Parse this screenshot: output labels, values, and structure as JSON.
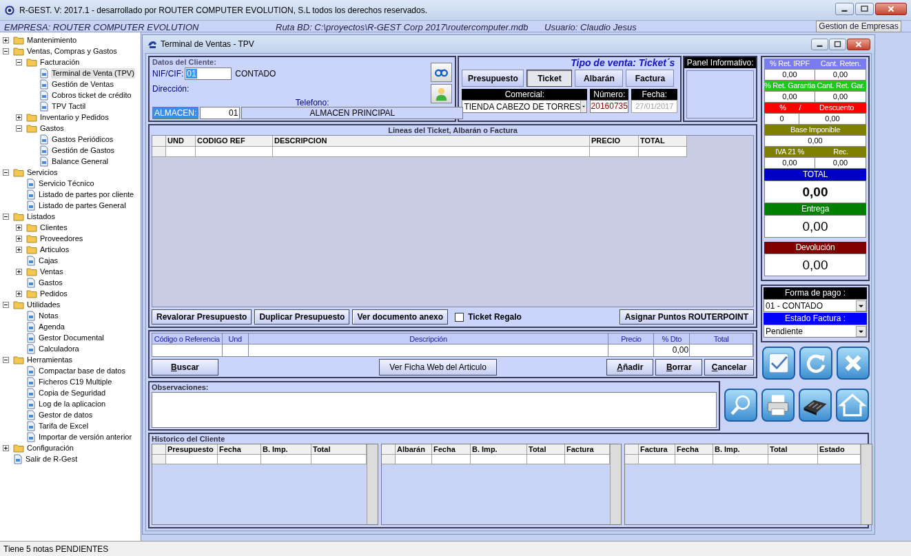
{
  "app": {
    "title": "R-GEST. V: 2017.1 - desarrollado por ROUTER COMPUTER EVOLUTION, S.L todos los derechos reservados."
  },
  "info_bar": {
    "empresa": "EMPRESA: ROUTER COMPUTER EVOLUTION",
    "ruta": "Ruta BD: C:\\proyectos\\R-GEST Corp 2017\\routercomputer.mdb",
    "usuario": "Usuario: Claudio Jesus",
    "button": "Gestion de Empresas"
  },
  "tree": [
    {
      "label": "Mantenimiento",
      "expanded": false,
      "selected": false
    },
    {
      "label": "Ventas, Compras y Gastos",
      "expanded": true,
      "selected": false,
      "children": [
        {
          "label": "Facturación",
          "expanded": true,
          "selected": false,
          "children": [
            {
              "label": "Terminal de Venta (TPV)",
              "selected": true
            },
            {
              "label": "Gestión de Ventas",
              "selected": false
            },
            {
              "label": "Cobros ticket de crédito",
              "selected": false
            },
            {
              "label": "TPV Tactil",
              "selected": false
            }
          ]
        },
        {
          "label": "Inventario y Pedidos",
          "expanded": false,
          "selected": false
        },
        {
          "label": "Gastos",
          "expanded": true,
          "selected": false,
          "children": [
            {
              "label": "Gastos Periódicos",
              "selected": false
            },
            {
              "label": "Gestión de Gastos",
              "selected": false
            },
            {
              "label": "Balance General",
              "selected": false
            }
          ]
        }
      ]
    },
    {
      "label": "Servicios",
      "expanded": true,
      "selected": false,
      "children": [
        {
          "label": "Servicio Técnico",
          "selected": false
        },
        {
          "label": "Listado de partes por cliente",
          "selected": false
        },
        {
          "label": "Listado de partes General",
          "selected": false
        }
      ]
    },
    {
      "label": "Listados",
      "expanded": true,
      "selected": false,
      "children": [
        {
          "label": "Clientes",
          "expanded": false,
          "selected": false
        },
        {
          "label": "Proveedores",
          "expanded": false,
          "selected": false
        },
        {
          "label": "Articulos",
          "expanded": false,
          "selected": false
        },
        {
          "label": "Cajas",
          "selected": false
        },
        {
          "label": "Ventas",
          "expanded": false,
          "selected": false
        },
        {
          "label": "Gastos",
          "selected": false
        },
        {
          "label": "Pedidos",
          "expanded": false,
          "selected": false
        }
      ]
    },
    {
      "label": "Utilidades",
      "expanded": true,
      "selected": false,
      "children": [
        {
          "label": "Notas",
          "selected": false
        },
        {
          "label": "Agenda",
          "selected": false
        },
        {
          "label": "Gestor Documental",
          "selected": false
        },
        {
          "label": "Calculadora",
          "selected": false
        }
      ]
    },
    {
      "label": "Herramientas",
      "expanded": true,
      "selected": false,
      "children": [
        {
          "label": "Compactar base de datos",
          "selected": false
        },
        {
          "label": "Ficheros C19 Multiple",
          "selected": false
        },
        {
          "label": "Copia de Seguridad",
          "selected": false
        },
        {
          "label": "Log de la aplicacion",
          "selected": false
        },
        {
          "label": "Gestor de datos",
          "selected": false
        },
        {
          "label": "Tarifa de Excel",
          "selected": false
        },
        {
          "label": "Importar de versión anterior",
          "selected": false
        }
      ]
    },
    {
      "label": "Configuración",
      "expanded": false,
      "selected": false
    },
    {
      "label": "Salir de R-Gest",
      "selected": false
    }
  ],
  "window": {
    "title": "Terminal de Ventas - TPV"
  },
  "cliente": {
    "heading": "Datos del Cliente:",
    "nif_label": "NIF/CIF:",
    "nif_value": "01",
    "nombre": "CONTADO",
    "direccion_label": "Dirección:",
    "telefono_label": "Telefono:",
    "almacen_label": "ALMACEN:",
    "almacen_code": "01",
    "almacen_name": "ALMACEN PRINCIPAL"
  },
  "venta": {
    "heading": "Tipo de venta: Ticket´s",
    "types": [
      {
        "label": "Presupuesto",
        "selected": false
      },
      {
        "label": "Ticket",
        "selected": true
      },
      {
        "label": "Albarán",
        "selected": false
      },
      {
        "label": "Factura",
        "selected": false
      }
    ],
    "comercial_label": "Comercial:",
    "comercial": "TIENDA CABEZO DE TORRES",
    "numero_label": "Número:",
    "numero": "20160735",
    "fecha_label": "Fecha:",
    "fecha": "27/01/2017"
  },
  "panel_info": {
    "heading": "Panel Informativo:"
  },
  "lineas": {
    "title": "Lineas del Ticket, Albarán o Factura",
    "columns": [
      "UND",
      "CODIGO REF",
      "DESCRIPCION",
      "PRECIO",
      "TOTAL"
    ],
    "buttons": [
      "Revalorar Presupuesto",
      "Duplicar Presupuesto",
      "Ver documento anexo"
    ],
    "gift": {
      "label": "Ticket Regalo",
      "checked": false
    },
    "points_button": "Asignar Puntos ROUTERPOINT"
  },
  "articulo": {
    "columns": [
      "Código o Referencia",
      "Und",
      "Descripción",
      "Precio",
      "% Dto",
      "Total"
    ],
    "dto_value": "0,00",
    "buttons": [
      {
        "label": "Buscar",
        "kind": "access"
      },
      {
        "label": "Ver Ficha Web del Articulo",
        "kind": "plain"
      },
      {
        "label": "Añadir",
        "kind": "access"
      },
      {
        "label": "Borrar",
        "kind": "access"
      },
      {
        "label": "Cancelar",
        "kind": "access"
      }
    ]
  },
  "observaciones": {
    "label": "Observaciones:"
  },
  "totals": [
    {
      "kind": "pair",
      "color": "#7b7bf0",
      "headers": [
        "% Ret. IRPF",
        "Cant. Reten."
      ],
      "values": [
        "0,00",
        "0,00"
      ]
    },
    {
      "kind": "pair",
      "color": "#1ec81e",
      "headers": [
        "% Ret. Garantia",
        "Cant. Ret. Gar."
      ],
      "values": [
        "0,00",
        "0,00"
      ]
    },
    {
      "kind": "split",
      "color": "#ff0000",
      "headers": [
        "%",
        "/",
        "Descuento"
      ],
      "values": [
        "0",
        "0,00"
      ]
    },
    {
      "kind": "single",
      "color": "#808000",
      "headers": [
        "Base Imponible"
      ],
      "values": [
        "0,00"
      ]
    },
    {
      "kind": "pair",
      "color": "#808000",
      "headers": [
        "IVA 21 %",
        "Rec."
      ],
      "values": [
        "0,00",
        "0,00"
      ]
    },
    {
      "kind": "big",
      "color": "#0000c8",
      "headers": [
        "TOTAL"
      ],
      "values": [
        "0,00"
      ],
      "bold": true
    },
    {
      "kind": "big",
      "color": "#008000",
      "headers": [
        "Entrega"
      ],
      "values": [
        "0,00"
      ]
    },
    {
      "kind": "big",
      "color": "#800000",
      "headers": [
        "Devolución"
      ],
      "values": [
        "0,00"
      ]
    }
  ],
  "pago": {
    "forma_label": "Forma de pago :",
    "forma": "01 - CONTADO",
    "estado_label": "Estado Factura :",
    "estado": "Pendiente"
  },
  "historico": {
    "title": "Historico del Cliente",
    "tables": [
      [
        "Presupuesto",
        "Fecha",
        "B. Imp.",
        "Total"
      ],
      [
        "Albarán",
        "Fecha",
        "B. Imp.",
        "Total",
        "Factura"
      ],
      [
        "Factura",
        "Fecha",
        "B. Imp.",
        "Total",
        "Estado"
      ]
    ]
  },
  "status": "Tiene 5 notas PENDIENTES"
}
